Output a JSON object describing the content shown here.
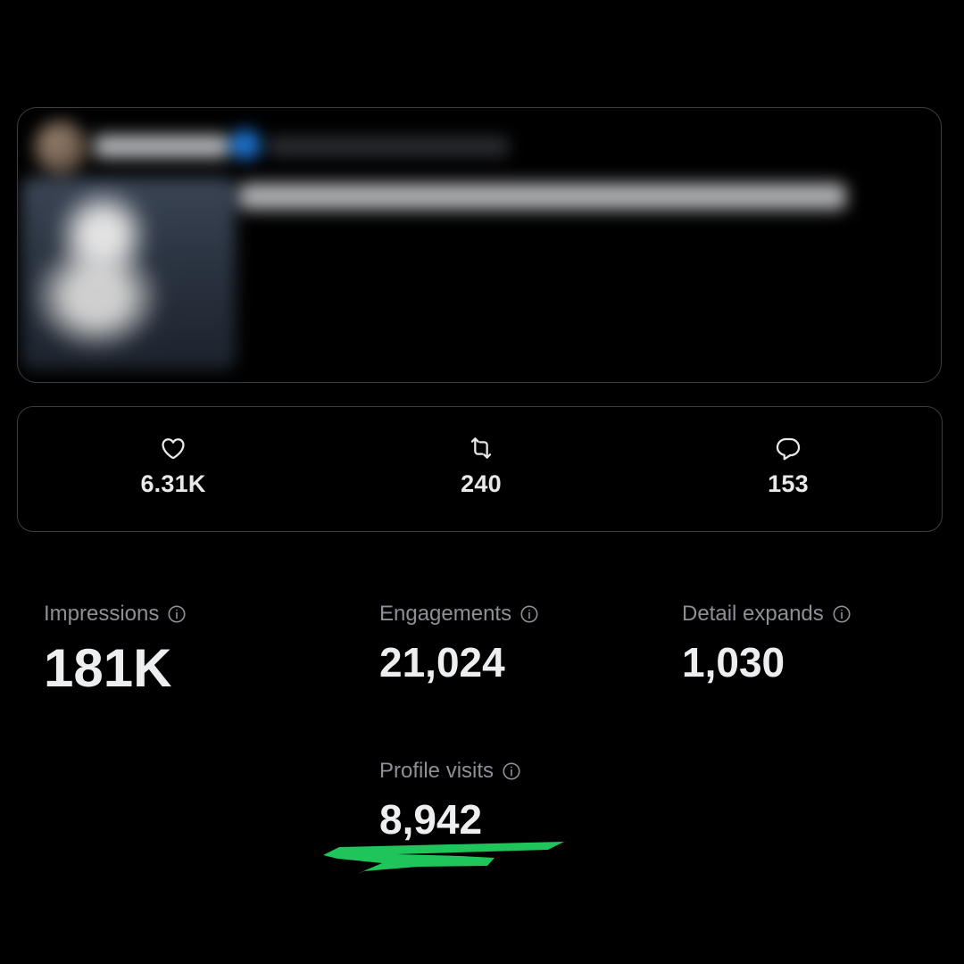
{
  "engagement": {
    "likes": {
      "icon": "heart-icon",
      "count": "6.31K"
    },
    "reposts": {
      "icon": "repost-icon",
      "count": "240"
    },
    "replies": {
      "icon": "reply-icon",
      "count": "153"
    }
  },
  "stats": {
    "impressions": {
      "label": "Impressions",
      "value": "181K"
    },
    "engagements": {
      "label": "Engagements",
      "value": "21,024"
    },
    "detail_expands": {
      "label": "Detail expands",
      "value": "1,030"
    },
    "profile_visits": {
      "label": "Profile visits",
      "value": "8,942"
    }
  },
  "colors": {
    "background": "#000000",
    "border": "#3a3d41",
    "label": "#8b9096",
    "value": "#eceef0",
    "highlight": "#1fc45a"
  }
}
